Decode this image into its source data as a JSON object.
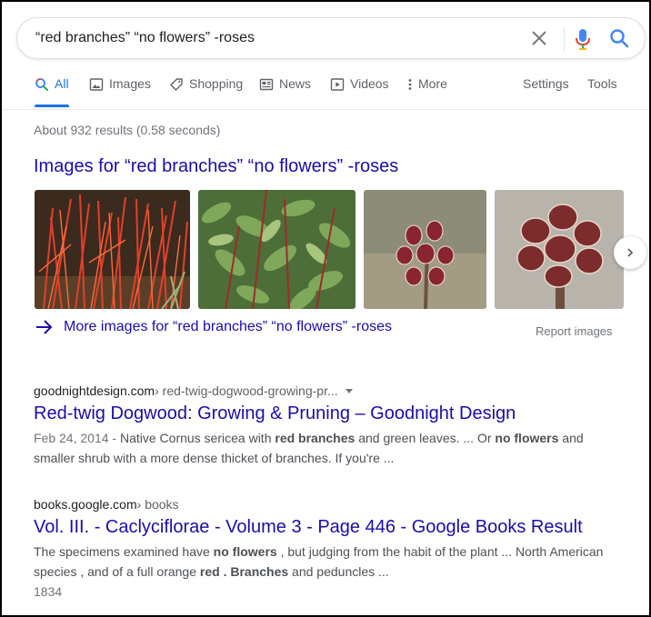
{
  "search": {
    "query": "“red branches” “no flowers” -roses"
  },
  "tabs": [
    {
      "label": "All",
      "icon": "search-icon",
      "active": true
    },
    {
      "label": "Images",
      "icon": "image-icon"
    },
    {
      "label": "Shopping",
      "icon": "tag-icon"
    },
    {
      "label": "News",
      "icon": "newspaper-icon"
    },
    {
      "label": "Videos",
      "icon": "play-icon"
    },
    {
      "label": "More",
      "icon": "vertical-dots-icon"
    }
  ],
  "tools": {
    "settings": "Settings",
    "tools": "Tools"
  },
  "stats": "About 932 results (0.58 seconds)",
  "images": {
    "heading": "Images for “red branches” “no flowers” -roses",
    "thumbnails": [
      {
        "subject": "red dogwood branches"
      },
      {
        "subject": "green shrub with red stems"
      },
      {
        "subject": "red buds cluster"
      },
      {
        "subject": "dark red seed pods cluster"
      }
    ],
    "more_link": "More images for “red branches” “no flowers” -roses",
    "report": "Report images"
  },
  "results": [
    {
      "site": "goodnightdesign.com",
      "path": " › red-twig-dogwood-growing-pr...",
      "title": "Red-twig Dogwood: Growing & Pruning – Goodnight Design",
      "date": "Feb 24, 2014",
      "sep": " - ",
      "snippet": [
        {
          "text": "Native Cornus sericea with ",
          "bold": false
        },
        {
          "text": "red branches",
          "bold": true
        },
        {
          "text": " and green leaves. ... Or ",
          "bold": false
        },
        {
          "text": "no flowers",
          "bold": true
        },
        {
          "text": " and smaller shrub with a more dense thicket of branches. If you're ...",
          "bold": false
        }
      ]
    },
    {
      "site": "books.google.com",
      "path": " › books",
      "title": "Vol. III. - Caclyciflorae - Volume 3 - Page 446 - Google Books Result",
      "snippet": [
        {
          "text": "The specimens examined have ",
          "bold": false
        },
        {
          "text": "no flowers",
          "bold": true
        },
        {
          "text": " , but judging from the habit of the plant ... North American species , and of a full orange ",
          "bold": false
        },
        {
          "text": "red . Branches",
          "bold": true
        },
        {
          "text": " and peduncles ...",
          "bold": false
        }
      ],
      "extra": "1834"
    }
  ],
  "colors": {
    "link": "#1a0dab",
    "accent": "#1a73e8",
    "muted": "#70757a"
  }
}
